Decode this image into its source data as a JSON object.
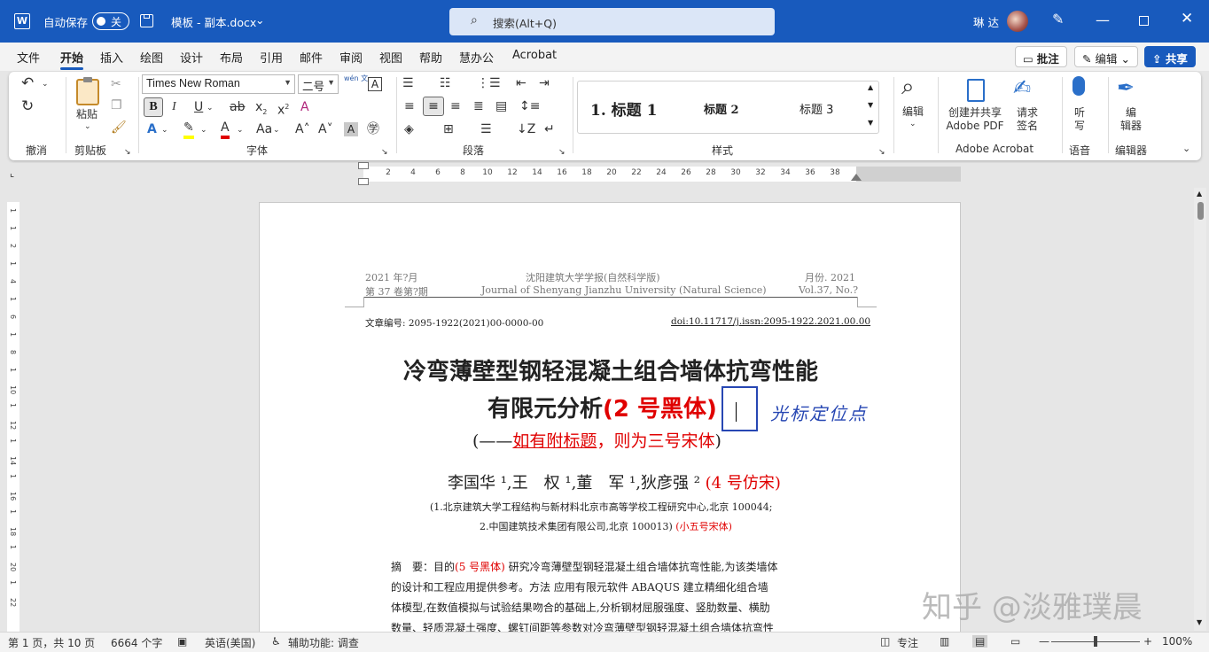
{
  "titlebar": {
    "autosave_label": "自动保存",
    "autosave_state": "关",
    "doc_title": "模板 - 副本.docx",
    "search_placeholder": "搜索(Alt+Q)",
    "user_name": "琳 达"
  },
  "menu": {
    "tabs": [
      "文件",
      "开始",
      "插入",
      "绘图",
      "设计",
      "布局",
      "引用",
      "邮件",
      "审阅",
      "视图",
      "帮助",
      "慧办公",
      "Acrobat"
    ],
    "active_tab": "开始",
    "comment_label": "批注",
    "edit_label": "编辑",
    "share_label": "共享"
  },
  "ribbon": {
    "groups": {
      "undo": "撤消",
      "clipboard": "剪贴板",
      "font": "字体",
      "paragraph": "段落",
      "styles": "样式",
      "acrobat": "Adobe Acrobat",
      "voice": "语音",
      "editor": "编辑器"
    },
    "paste_label": "粘贴",
    "font_name": "Times New Roman",
    "font_size": "二号",
    "wen_label": "wén 文",
    "styles": [
      "1.  标题 1",
      "标题 2",
      "标题 3"
    ],
    "editing_label": "编辑",
    "create_pdf_line1": "创建并共享",
    "create_pdf_line2": "Adobe PDF",
    "sign_line1": "请求",
    "sign_line2": "签名",
    "listen_line1": "听",
    "listen_line2": "写",
    "editor_line1": "编",
    "editor_line2": "辑器"
  },
  "ruler": {
    "ticks": [
      "2",
      "4",
      "6",
      "8",
      "10",
      "12",
      "14",
      "16",
      "18",
      "20",
      "22",
      "24",
      "26",
      "28",
      "30",
      "32",
      "34",
      "36",
      "38"
    ],
    "vticks": [
      "1",
      "1",
      "2",
      "1",
      "4",
      "1",
      "6",
      "1",
      "8",
      "1",
      "10",
      "1",
      "12",
      "1",
      "14",
      "1",
      "16",
      "1",
      "18",
      "1",
      "20",
      "1",
      "22"
    ]
  },
  "document": {
    "header_left_1": "2021 年?月",
    "header_left_2": "第 37 卷第?期",
    "header_center_1": "沈阳建筑大学学报(自然科学版)",
    "header_center_2": "Journal of Shenyang Jianzhu University (Natural Science)",
    "header_right_1": "月份. 2021",
    "header_right_2": "Vol.37, No.?",
    "article_no": "文章编号: 2095-1922(2021)00-0000-00",
    "doi": "doi:10.11717/j.issn:2095-1922.2021.00.00",
    "title_line1": "冷弯薄壁型钢轻混凝土组合墙体抗弯性能",
    "title_line2": "有限元分析",
    "title_note": "(2 号黑体)",
    "cursor_annotation": "光标定位点",
    "subtitle_open": "(——",
    "subtitle_link": "如有附标题",
    "subtitle_rest": "，则为三号宋体",
    "subtitle_close": ")",
    "authors": "李国华 ¹,王　权 ¹,董　军 ¹,狄彦强 ² ",
    "authors_note": "(4 号仿宋)",
    "affil_1": "(1.北京建筑大学工程结构与新材料北京市高等学校工程研究中心,北京  100044;",
    "affil_2": "2.中国建筑技术集团有限公司,北京  100013) ",
    "affil_note": "(小五号宋体)",
    "abstract_label": "摘　要：目的",
    "abstract_note": "(5 号黑体)",
    "abstract_1": " 研究冷弯薄壁型钢轻混凝土组合墙体抗弯性能,为该类墙体",
    "abstract_2": "的设计和工程应用提供参考。方法  应用有限元软件 ABAQUS 建立精细化组合墙",
    "abstract_3": "体模型,在数值模拟与试验结果吻合的基础上,分析钢材屈服强度、竖肋数量、横肋",
    "abstract_4": "数量、轻质混凝土强度、螺钉间距等参数对冷弯薄壁型钢轻混凝土组合墙体抗弯性"
  },
  "watermark": "知乎 @淡雅璞晨",
  "status": {
    "page": "第 1 页，共 10 页",
    "words": "6664 个字",
    "language": "英语(美国)",
    "accessibility": "辅助功能: 调查",
    "focus": "专注",
    "zoom": "100%"
  },
  "colors": {
    "brand": "#185abd",
    "note_red": "#e00000",
    "annotation_blue": "#2747b3"
  }
}
